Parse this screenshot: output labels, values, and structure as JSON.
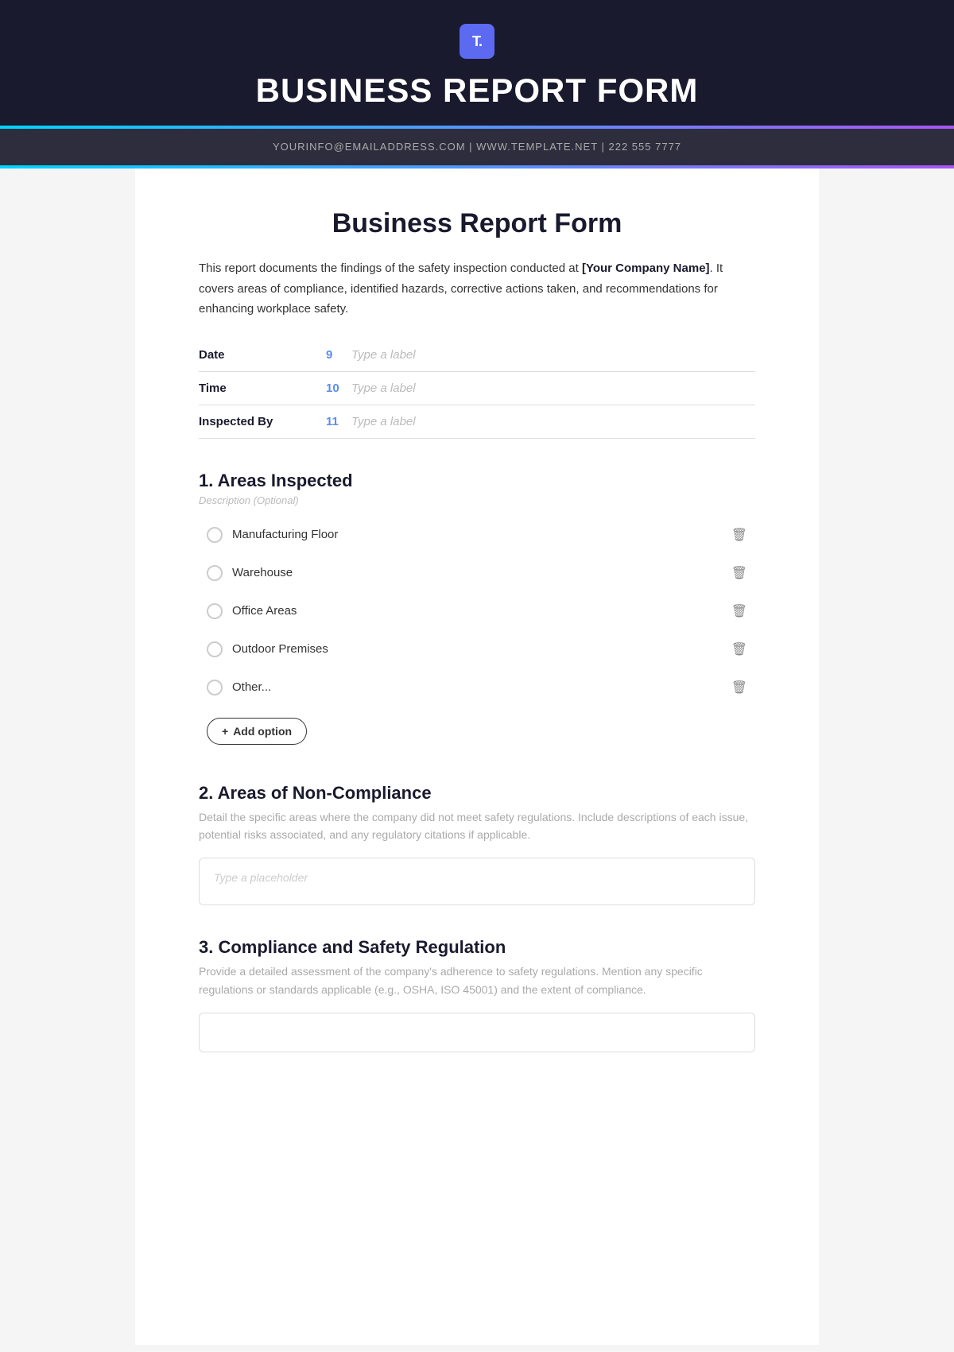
{
  "header": {
    "logo_text": "T.",
    "title": "BUSINESS REPORT FORM",
    "contact": "YOURINFO@EMAILADDRESS.COM | WWW.TEMPLATE.NET | 222 555 7777"
  },
  "form": {
    "title": "Business Report Form",
    "description_start": "This report documents the findings of the safety inspection conducted at ",
    "description_bold": "[Your Company Name]",
    "description_end": ". It covers areas of compliance, identified hazards, corrective actions taken, and recommendations for enhancing workplace safety.",
    "fields": [
      {
        "label": "Date",
        "number": "9",
        "placeholder": "Type a label"
      },
      {
        "label": "Time",
        "number": "10",
        "placeholder": "Type a label"
      },
      {
        "label": "Inspected By",
        "number": "11",
        "placeholder": "Type a label"
      }
    ],
    "sections": [
      {
        "id": "section-1",
        "number": "1",
        "title": "Areas Inspected",
        "description_optional": "Description (Optional)",
        "type": "radio",
        "options": [
          "Manufacturing Floor",
          "Warehouse",
          "Office Areas",
          "Outdoor Premises",
          "Other..."
        ],
        "add_option_label": "Add option"
      },
      {
        "id": "section-2",
        "number": "2",
        "title": "Areas of Non-Compliance",
        "description": "Detail the specific areas where the company did not meet safety regulations. Include descriptions of each issue, potential risks associated, and any regulatory citations if applicable.",
        "type": "textarea",
        "placeholder": "Type a placeholder"
      },
      {
        "id": "section-3",
        "number": "3",
        "title": "Compliance and Safety Regulation",
        "description": "Provide a detailed assessment of the company's adherence to safety regulations. Mention any specific regulations or standards applicable (e.g., OSHA, ISO 45001) and the extent of compliance.",
        "type": "textarea",
        "placeholder": ""
      }
    ]
  },
  "icons": {
    "trash": "🗑",
    "plus": "+"
  }
}
